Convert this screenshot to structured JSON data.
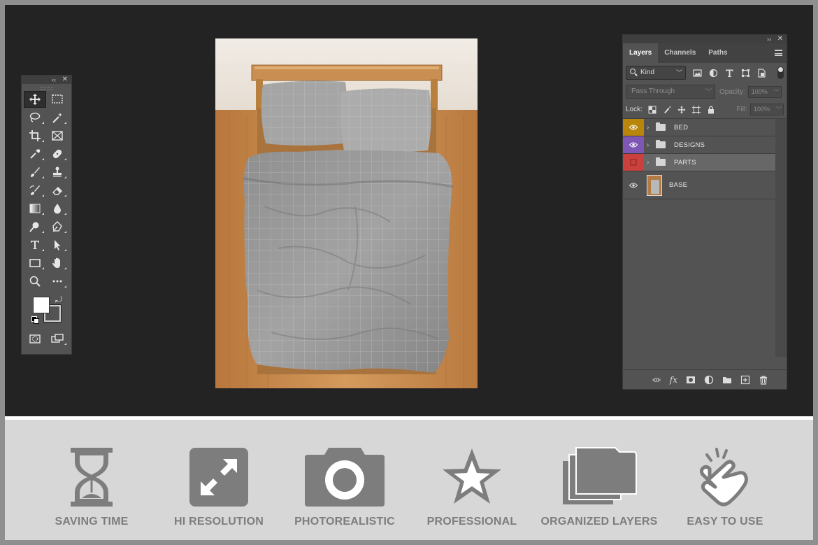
{
  "layers_panel": {
    "tabs": [
      "Layers",
      "Channels",
      "Paths"
    ],
    "active_tab": "Layers",
    "filter_label": "Kind",
    "blend_mode": "Pass Through",
    "opacity_label": "Opacity:",
    "opacity_value": "100%",
    "lock_label": "Lock:",
    "fill_label": "Fill:",
    "fill_value": "100%",
    "layers": [
      {
        "name": "BED",
        "type": "group",
        "color": "#b8860b"
      },
      {
        "name": "DESIGNS",
        "type": "group",
        "color": "#7e57b5"
      },
      {
        "name": "PARTS",
        "type": "group",
        "color": "#c9403c"
      },
      {
        "name": "BASE",
        "type": "image",
        "color": ""
      }
    ]
  },
  "features": [
    {
      "label": "SAVING TIME",
      "icon": "hourglass-icon"
    },
    {
      "label": "HI RESOLUTION",
      "icon": "expand-arrows-icon"
    },
    {
      "label": "PHOTOREALISTIC",
      "icon": "camera-icon"
    },
    {
      "label": "PROFESSIONAL",
      "icon": "star-icon"
    },
    {
      "label": "ORGANIZED LAYERS",
      "icon": "stacked-folders-icon"
    },
    {
      "label": "EASY TO USE",
      "icon": "tap-hand-icon"
    }
  ],
  "colors": {
    "workspace": "#232323",
    "panel": "#535353",
    "feature_bar": "#d7d7d7",
    "feature_icon": "#7d7d7d"
  }
}
